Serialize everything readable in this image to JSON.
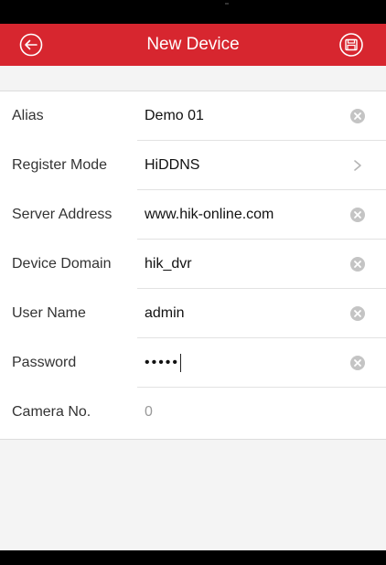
{
  "header": {
    "title": "New Device",
    "back_icon": "back-arrow-circle-icon",
    "save_icon": "floppy-disk-icon",
    "accent_color": "#d7262f"
  },
  "form": {
    "alias": {
      "label": "Alias",
      "value": "Demo 01"
    },
    "register_mode": {
      "label": "Register Mode",
      "value": "HiDDNS"
    },
    "server_address": {
      "label": "Server Address",
      "value": "www.hik-online.com"
    },
    "device_domain": {
      "label": "Device Domain",
      "value": "hik_dvr"
    },
    "user_name": {
      "label": "User Name",
      "value": "admin"
    },
    "password": {
      "label": "Password",
      "masked_value": "•••••"
    },
    "camera_no": {
      "label": "Camera No.",
      "value": "0"
    }
  }
}
